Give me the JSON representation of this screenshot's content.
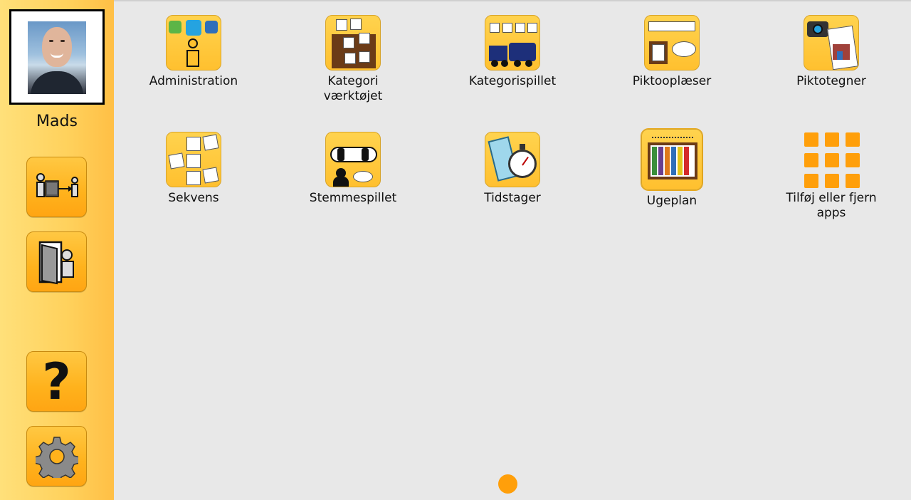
{
  "profile": {
    "name": "Mads"
  },
  "sidebar": {
    "buttons": [
      {
        "icon": "user-switch-icon"
      },
      {
        "icon": "logout-door-icon"
      },
      {
        "icon": "help-question-icon",
        "glyph": "?"
      },
      {
        "icon": "settings-gear-icon"
      }
    ]
  },
  "apps": [
    {
      "label": "Administration",
      "icon": "administration-icon"
    },
    {
      "label": "Kategori\nværktøjet",
      "icon": "category-tool-icon"
    },
    {
      "label": "Kategorispillet",
      "icon": "category-game-icon"
    },
    {
      "label": "Piktooplæser",
      "icon": "pictogram-reader-icon"
    },
    {
      "label": "Piktotegner",
      "icon": "pictogram-drawer-icon"
    },
    {
      "label": "Sekvens",
      "icon": "sequence-icon"
    },
    {
      "label": "Stemmespillet",
      "icon": "voice-game-icon"
    },
    {
      "label": "Tidstager",
      "icon": "timer-icon"
    },
    {
      "label": "Ugeplan",
      "icon": "week-plan-icon"
    },
    {
      "label": "Tilføj eller fjern\napps",
      "icon": "add-remove-apps-icon"
    }
  ],
  "pager": {
    "current_page": 1,
    "pages": 1
  },
  "colors": {
    "accent": "#ff9f0a",
    "sidebar_start": "#ffe07a",
    "sidebar_end": "#ffbf45",
    "background": "#e8e8e8"
  }
}
